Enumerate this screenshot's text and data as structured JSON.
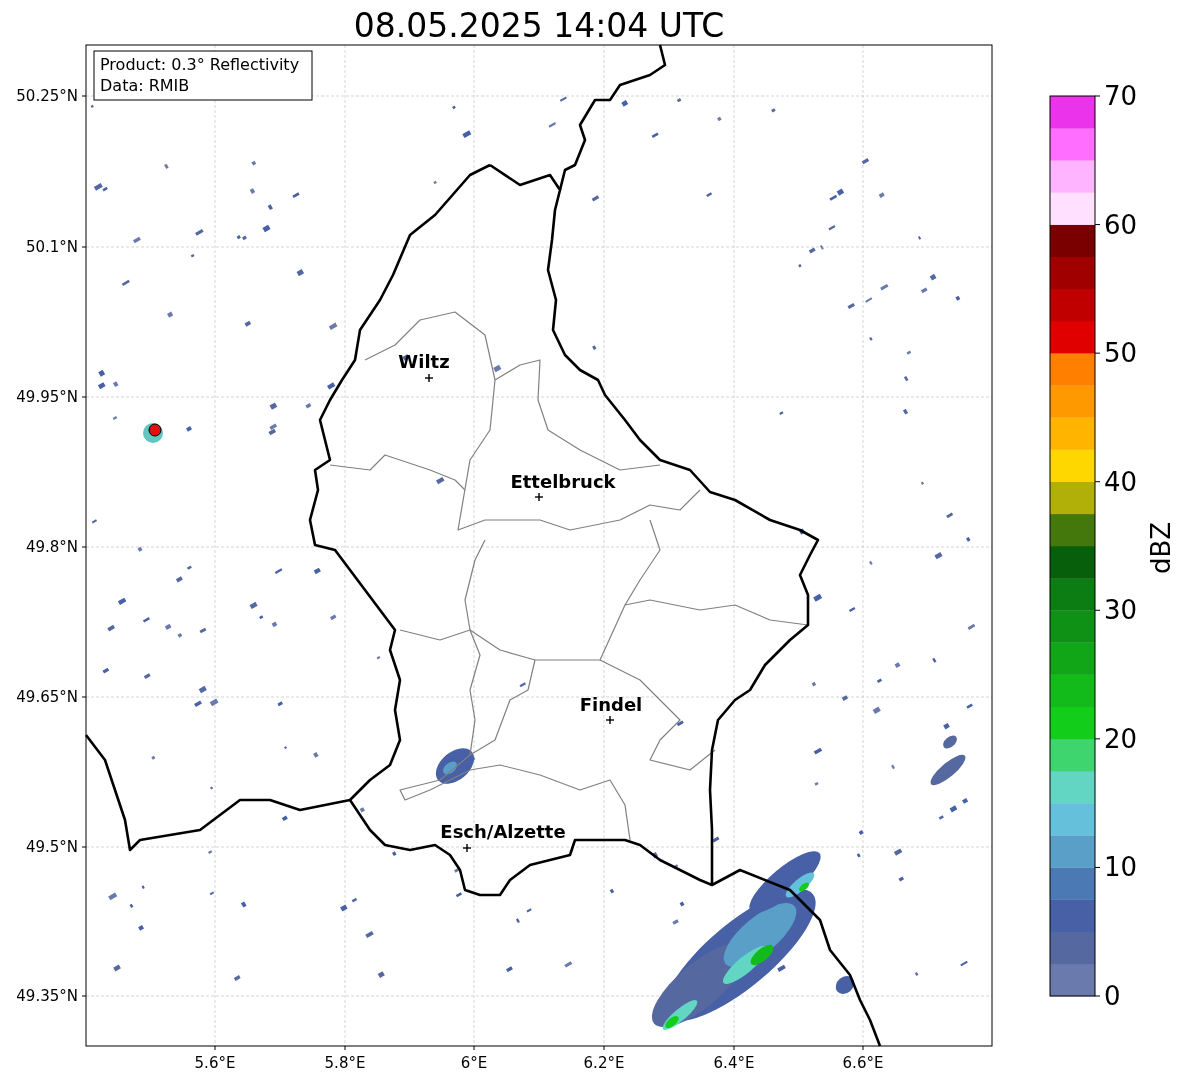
{
  "title": "08.05.2025 14:04 UTC",
  "info_box": [
    "Product: 0.3° Reflectivity",
    "Data: RMIB"
  ],
  "lat_ticks": [
    "50.25°N",
    "50.1°N",
    "49.95°N",
    "49.8°N",
    "49.65°N",
    "49.5°N",
    "49.35°N"
  ],
  "lon_ticks": [
    "5.6°E",
    "5.8°E",
    "6°E",
    "6.2°E",
    "6.4°E",
    "6.6°E"
  ],
  "cities": [
    {
      "name": "Wiltz"
    },
    {
      "name": "Ettelbruck"
    },
    {
      "name": "Findel"
    },
    {
      "name": "Esch/Alzette"
    }
  ],
  "colorbar": {
    "label": "dBZ",
    "ticks": [
      "70",
      "60",
      "50",
      "40",
      "30",
      "20",
      "10",
      "0"
    ],
    "bands": [
      {
        "color": "#6a7aad"
      },
      {
        "color": "#5668a0"
      },
      {
        "color": "#4760a6"
      },
      {
        "color": "#4b79b3"
      },
      {
        "color": "#599fc8"
      },
      {
        "color": "#65c0dc"
      },
      {
        "color": "#62d6c3"
      },
      {
        "color": "#3fd56e"
      },
      {
        "color": "#12cd1a"
      },
      {
        "color": "#12bb19"
      },
      {
        "color": "#10a617"
      },
      {
        "color": "#0e9115"
      },
      {
        "color": "#0c7d12"
      },
      {
        "color": "#075e0b"
      },
      {
        "color": "#44780c"
      },
      {
        "color": "#b0b008"
      },
      {
        "color": "#ffd700"
      },
      {
        "color": "#ffb400"
      },
      {
        "color": "#ff9900"
      },
      {
        "color": "#ff7f00"
      },
      {
        "color": "#e00000"
      },
      {
        "color": "#c00000"
      },
      {
        "color": "#a00000"
      },
      {
        "color": "#7a0000"
      },
      {
        "color": "#ffe0ff"
      },
      {
        "color": "#ffb4ff"
      },
      {
        "color": "#ff6eff"
      },
      {
        "color": "#ea33ea"
      }
    ]
  }
}
